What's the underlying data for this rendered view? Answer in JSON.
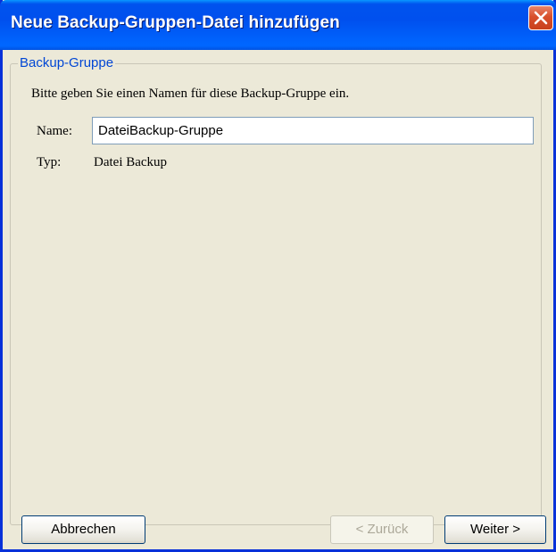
{
  "window": {
    "title": "Neue Backup-Gruppen-Datei hinzufügen",
    "close_icon": "close-icon"
  },
  "group": {
    "legend": "Backup-Gruppe",
    "instruction": "Bitte geben Sie einen Namen für diese Backup-Gruppe ein.",
    "name_label": "Name:",
    "name_value": "DateiBackup-Gruppe",
    "type_label": "Typ:",
    "type_value": "Datei Backup"
  },
  "buttons": {
    "cancel": "Abbrechen",
    "back": "< Zurück",
    "back_enabled": false,
    "next": "Weiter >"
  },
  "colors": {
    "titlebar": "#0053ee",
    "legend_text": "#0046d5",
    "close_button": "#d8502c",
    "dialog_background": "#ece9d8"
  }
}
